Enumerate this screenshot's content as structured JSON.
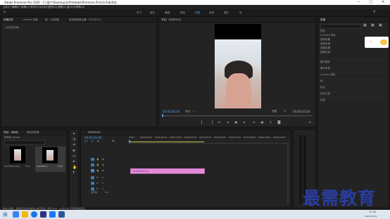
{
  "titlebar": {
    "title": "Adobe Premiere Pro 2020 - C:\\用户\\Desktop\\文件\\Adobe\\Premiere Pro\\14.0\\未命名"
  },
  "window_controls": {
    "minimize": "─",
    "maximize": "□",
    "close": "✕"
  },
  "menu": [
    "文件(F)",
    "编辑(E)",
    "剪辑(C)",
    "序列(S)",
    "标记(M)",
    "图形(G)",
    "视图(V)",
    "窗口(W)",
    "帮助(H)"
  ],
  "workspaces": [
    "学习",
    "组件",
    "编辑",
    "颜色",
    "效果",
    "音频",
    "图形",
    "库"
  ],
  "active_workspace": "效果",
  "source_panel": {
    "tabs": [
      "效果控件",
      "Lumetri 范围",
      "源：(无剪辑)",
      "音频剪辑混合器：20200101"
    ],
    "placeholder": "(未选择剪辑)"
  },
  "program_monitor": {
    "tab": "节目：20200101",
    "timecode_left": "00;00;00;00",
    "fit": "适合",
    "quality": "完整",
    "timecode_right": "00;00;03;00"
  },
  "project_panel": {
    "tabs": [
      "项目：未命名",
      "媒体浏览器"
    ],
    "path": "未命名.prproj",
    "items": [
      {
        "name": "20200101.png",
        "duration": "5;00"
      },
      {
        "name": "20200101",
        "duration": "5;00"
      }
    ]
  },
  "timeline": {
    "tab": "20200101",
    "timecode": "00;00;00;00",
    "ruler": [
      "00;00",
      "00;00;01;00",
      "00;00;02;00",
      "00;00;03;00",
      "00;00;04;00",
      "00;00;05;00",
      "00;00;06;00",
      "00;00;07;00",
      "00;00;08;00",
      "00;00;09;00",
      "00;00;10;00"
    ],
    "video_tracks": [
      "V3",
      "V2",
      "V1"
    ],
    "audio_tracks": [
      "A1",
      "A2",
      "A3"
    ],
    "master": "主声道",
    "master_value": "0.0",
    "clip_label": "20200101.png"
  },
  "right_panel": {
    "tab": "效果",
    "tree": [
      "预设",
      "Lumetri 预设",
      "音频效果",
      "音频过渡",
      "视频效果",
      "视频过渡"
    ],
    "sections": [
      "基本图形",
      "基本声音",
      "Lumetri 颜色",
      "库",
      "标记",
      "历史记录",
      "信息"
    ]
  },
  "status_bar": {
    "text": "单击以选择，或单击空白处并拖动以进行框选。使用 Shift、Alt 和 Ctrl 可获得其他选项。"
  },
  "watermark": {
    "text": "最需教育"
  },
  "taskbar": {
    "time": "17:05",
    "date": "2021/11/19"
  }
}
